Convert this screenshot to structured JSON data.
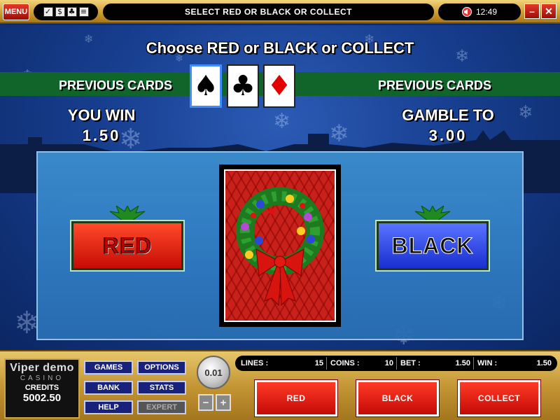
{
  "topbar": {
    "menu_label": "MENU",
    "status_message": "SELECT RED OR BLACK OR COLLECT",
    "clock": "12:49",
    "tool_icons": [
      "check-icon",
      "money-icon",
      "cards-icon",
      "notes-icon"
    ]
  },
  "gamble": {
    "title": "Choose RED or BLACK or COLLECT",
    "prev_cards_left": "PREVIOUS CARDS",
    "prev_cards_right": "PREVIOUS CARDS",
    "previous_cards": [
      {
        "suit": "spade",
        "symbol": "♠",
        "color": "#000000"
      },
      {
        "suit": "club",
        "symbol": "♣",
        "color": "#000000"
      },
      {
        "suit": "diamond",
        "symbol": "♦",
        "color": "#e00000"
      }
    ],
    "you_win_label": "YOU WIN",
    "you_win_value": "1.50",
    "gamble_to_label": "GAMBLE TO",
    "gamble_to_value": "3.00",
    "red_choice": "RED",
    "black_choice": "BLACK"
  },
  "bottom": {
    "logo_main": "Viper demo",
    "logo_sub": "CASINO",
    "credits_label": "CREDITS",
    "credits_value": "5002.50",
    "nav": {
      "games": "GAMES",
      "options": "OPTIONS",
      "bank": "BANK",
      "stats": "STATS",
      "help": "HELP",
      "expert": "EXPERT"
    },
    "coin_value": "0.01",
    "minus": "−",
    "plus": "+",
    "info": {
      "lines_label": "LINES :",
      "lines_value": "15",
      "coins_label": "COINS :",
      "coins_value": "10",
      "bet_label": "BET :",
      "bet_value": "1.50",
      "win_label": "WIN :",
      "win_value": "1.50"
    },
    "actions": {
      "red": "RED",
      "black": "BLACK",
      "collect": "COLLECT"
    }
  },
  "colors": {
    "accent_gold": "#c99a2f",
    "button_red": "#c40a06",
    "button_blue": "#1a2fd0",
    "band_green": "#11652a"
  }
}
